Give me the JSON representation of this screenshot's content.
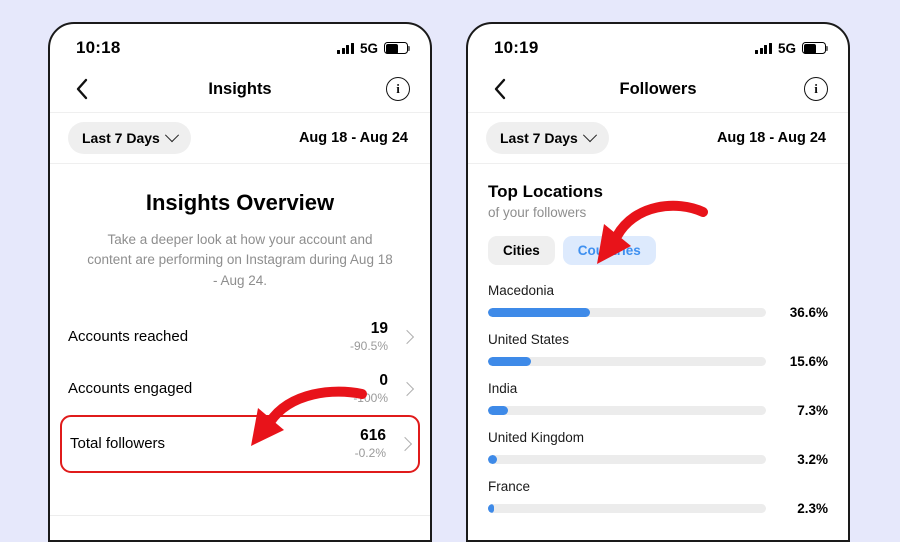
{
  "theme": {
    "page_background": "#e6e8fb",
    "accent_blue": "#3e8ae8",
    "tab_active_text": "#3f90f0",
    "tab_active_bg": "#ddeafd",
    "highlight_red": "#e01b1b",
    "muted_text": "#8e8e8e"
  },
  "phone_left": {
    "status": {
      "time": "10:18",
      "network": "5G",
      "signal_icon": "signal-bars-icon",
      "battery_icon": "battery-icon",
      "battery_level": 55
    },
    "nav": {
      "back_icon": "chevron-left-icon",
      "title": "Insights",
      "info_icon": "info-circle-icon",
      "info_glyph": "i"
    },
    "range": {
      "selector_label": "Last 7 Days",
      "chevron_icon": "chevron-down-icon",
      "date_range": "Aug 18 - Aug 24"
    },
    "overview": {
      "title": "Insights Overview",
      "subtitle": "Take a deeper look at how your account and content are performing on Instagram during Aug 18 - Aug 24."
    },
    "metrics": [
      {
        "label": "Accounts reached",
        "value": "19",
        "delta": "-90.5%",
        "chevron_icon": "chevron-right-icon",
        "highlighted": false
      },
      {
        "label": "Accounts engaged",
        "value": "0",
        "delta": "-100%",
        "chevron_icon": "chevron-right-icon",
        "highlighted": false
      },
      {
        "label": "Total followers",
        "value": "616",
        "delta": "-0.2%",
        "chevron_icon": "chevron-right-icon",
        "highlighted": true
      }
    ]
  },
  "phone_right": {
    "status": {
      "time": "10:19",
      "network": "5G",
      "signal_icon": "signal-bars-icon",
      "battery_icon": "battery-icon",
      "battery_level": 55
    },
    "nav": {
      "back_icon": "chevron-left-icon",
      "title": "Followers",
      "info_icon": "info-circle-icon",
      "info_glyph": "i"
    },
    "range": {
      "selector_label": "Last 7 Days",
      "chevron_icon": "chevron-down-icon",
      "date_range": "Aug 18 - Aug 24"
    },
    "locations": {
      "title": "Top Locations",
      "subtitle": "of your followers",
      "tabs": [
        {
          "label": "Cities",
          "selected": false
        },
        {
          "label": "Countries",
          "selected": true
        }
      ]
    },
    "chart_data": {
      "type": "bar",
      "title": "Top Locations",
      "subtitle": "of your followers",
      "orientation": "horizontal",
      "xlabel": "",
      "ylabel": "",
      "xlim": [
        0,
        100
      ],
      "grid": false,
      "legend": null,
      "unit": "%",
      "categories": [
        "Macedonia",
        "United States",
        "India",
        "United Kingdom",
        "France"
      ],
      "values": [
        36.6,
        15.6,
        7.3,
        3.2,
        2.3
      ],
      "value_labels": [
        "36.6%",
        "15.6%",
        "7.3%",
        "3.2%",
        "2.3%"
      ],
      "bar_fill_fraction": [
        36.6,
        15.6,
        7.3,
        3.2,
        2.3
      ]
    }
  },
  "annotations": [
    {
      "name": "arrow-to-total-followers",
      "shape": "curved-arrow",
      "color": "#e8131a",
      "points_to": "Total followers"
    },
    {
      "name": "arrow-to-countries-tab",
      "shape": "curved-arrow",
      "color": "#e8131a",
      "points_to": "Countries"
    }
  ]
}
